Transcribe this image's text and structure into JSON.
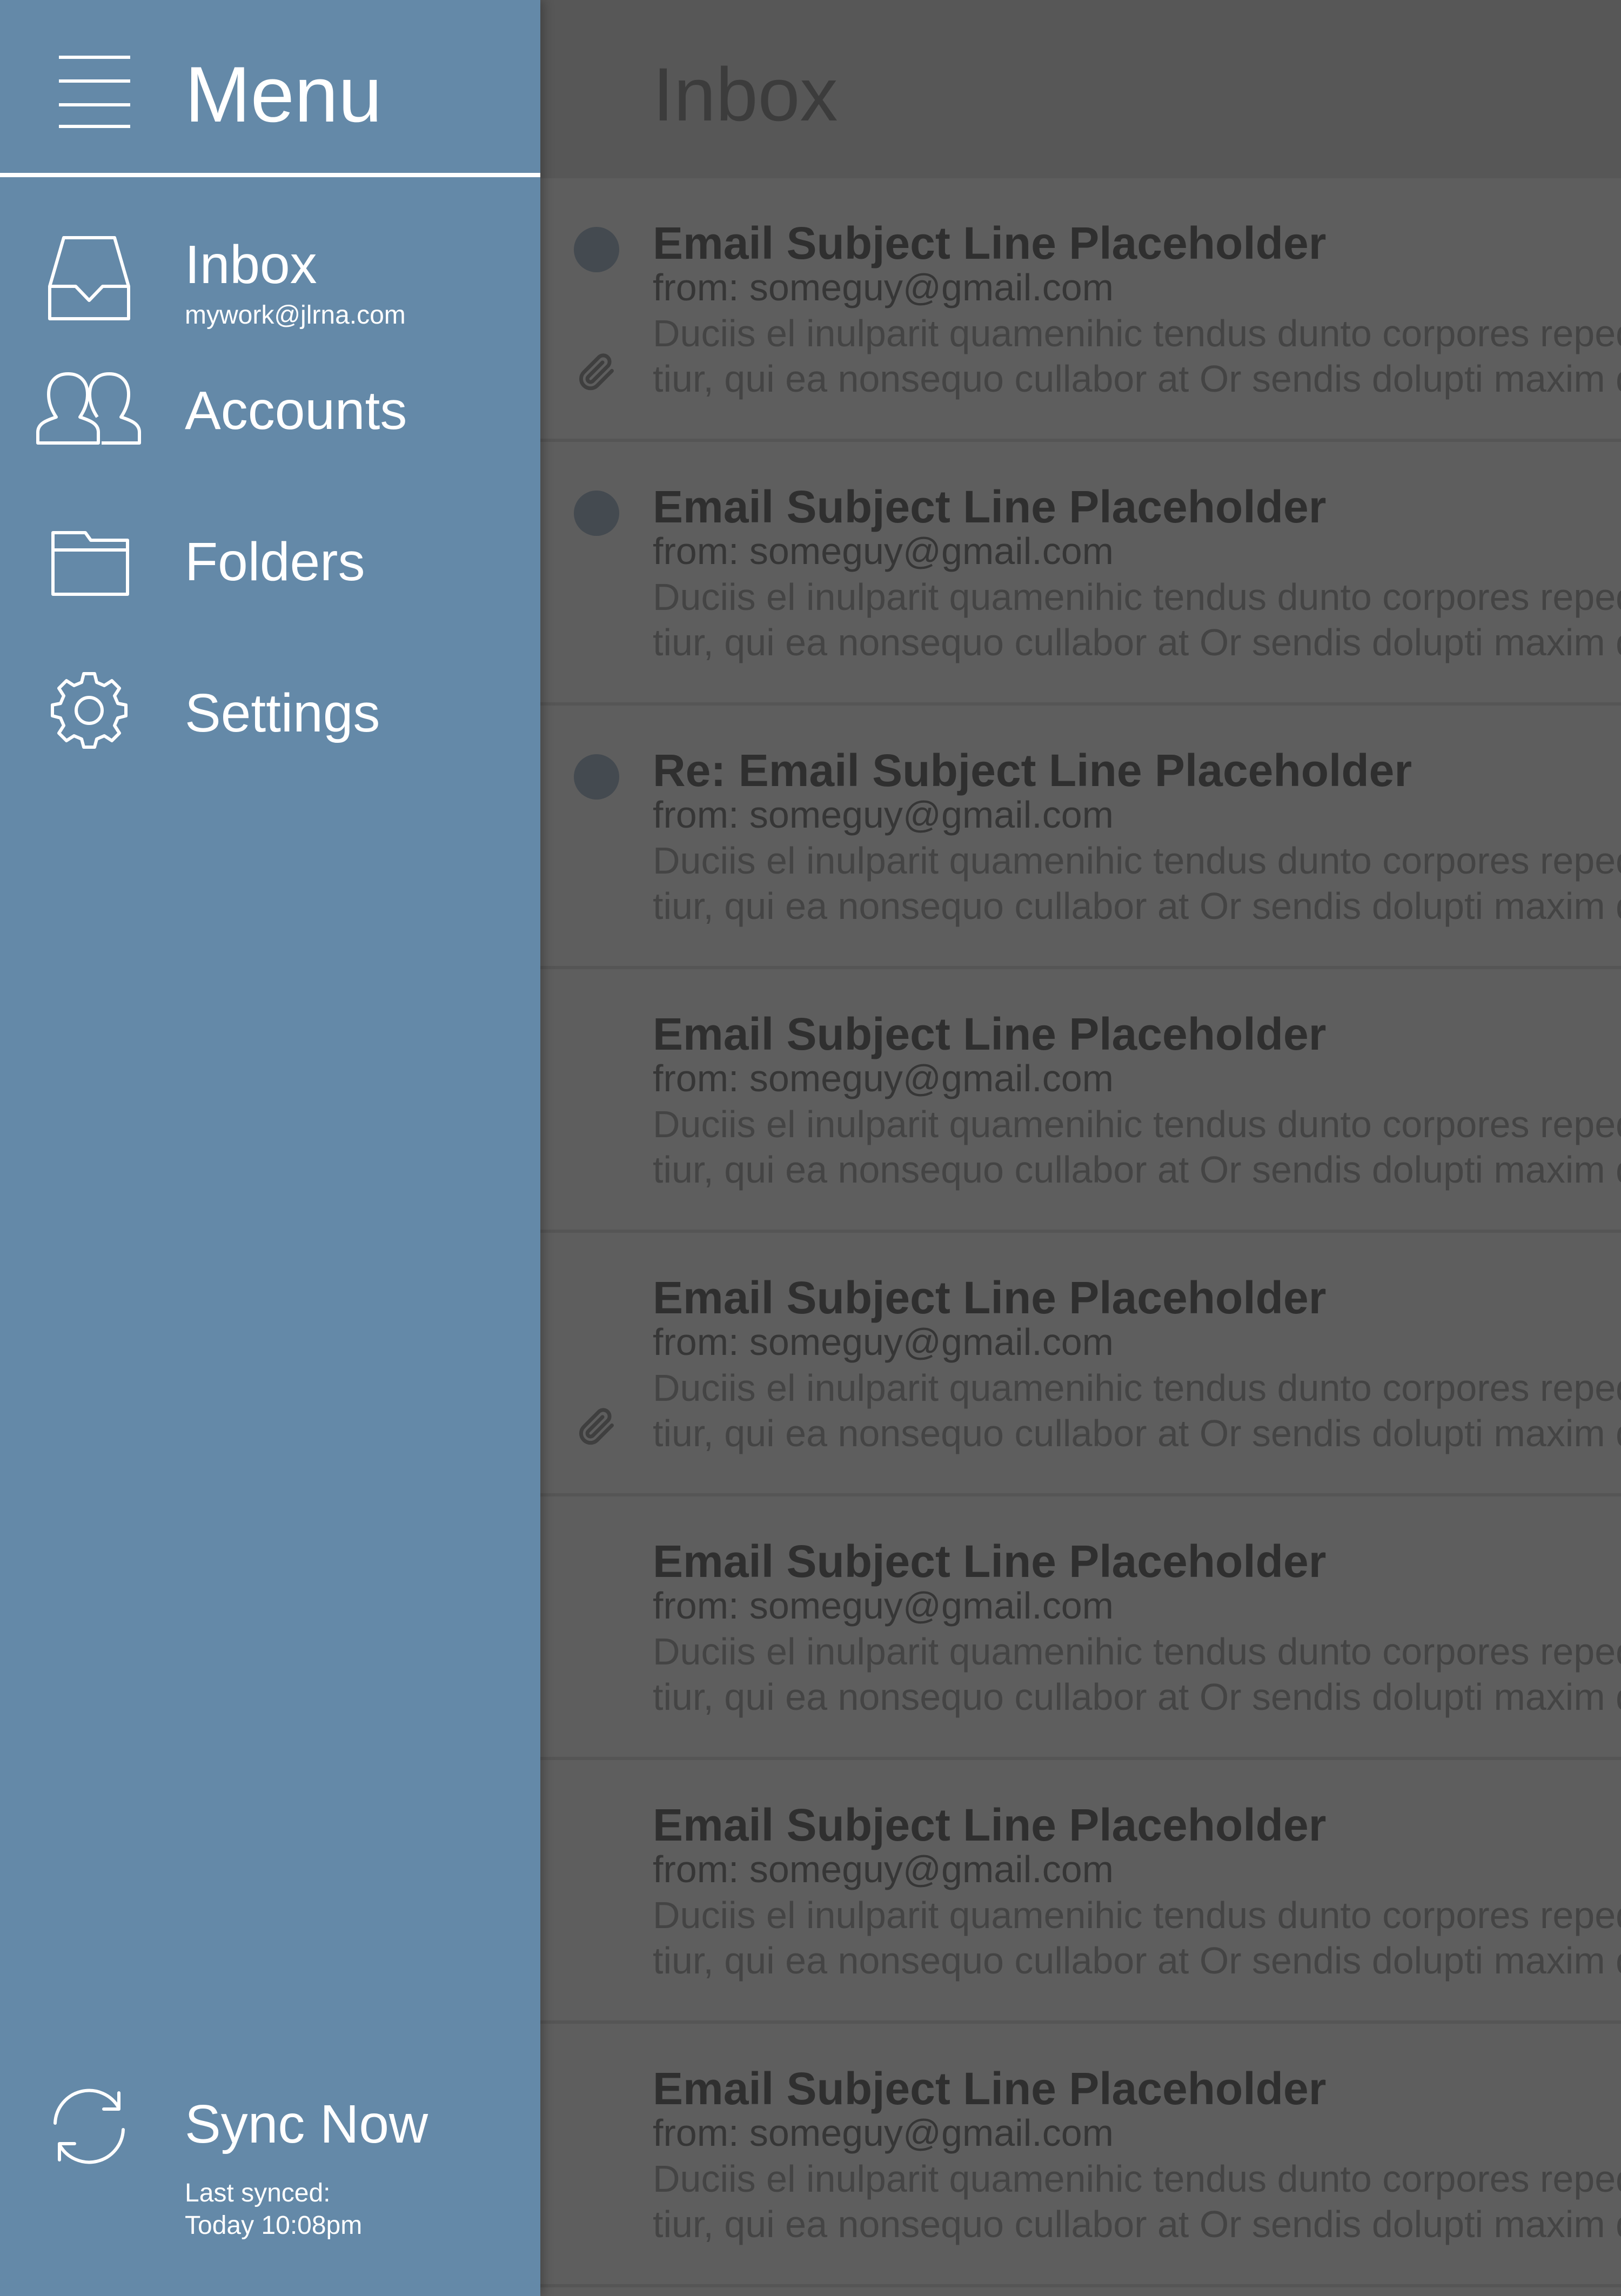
{
  "inbox": {
    "title": "Inbox",
    "emails": [
      {
        "subject": "Email Subject Line Placeholder",
        "from": "from: someguy@gmail.com",
        "preview_line1": "Duciis el inulparit quamenihic tendus dunto corpores reped",
        "preview_line2": "tiur, qui ea nonsequo cullabor at Or sendis dolupti maxim d",
        "unread": true,
        "attachment": true
      },
      {
        "subject": "Email Subject Line Placeholder",
        "from": "from: someguy@gmail.com",
        "preview_line1": "Duciis el inulparit quamenihic tendus dunto corpores reped",
        "preview_line2": "tiur, qui ea nonsequo cullabor at Or sendis dolupti maxim d",
        "unread": true,
        "attachment": false
      },
      {
        "subject": "Re: Email Subject Line Placeholder",
        "from": "from: someguy@gmail.com",
        "preview_line1": "Duciis el inulparit quamenihic tendus dunto corpores reped",
        "preview_line2": "tiur, qui ea nonsequo cullabor at Or sendis dolupti maxim d",
        "unread": true,
        "attachment": false
      },
      {
        "subject": "Email Subject Line Placeholder",
        "from": "from: someguy@gmail.com",
        "preview_line1": "Duciis el inulparit quamenihic tendus dunto corpores reped",
        "preview_line2": "tiur, qui ea nonsequo cullabor at Or sendis dolupti maxim d",
        "unread": false,
        "attachment": false
      },
      {
        "subject": "Email Subject Line Placeholder",
        "from": "from: someguy@gmail.com",
        "preview_line1": "Duciis el inulparit quamenihic tendus dunto corpores reped",
        "preview_line2": "tiur, qui ea nonsequo cullabor at Or sendis dolupti maxim d",
        "unread": false,
        "attachment": true
      },
      {
        "subject": "Email Subject Line Placeholder",
        "from": "from: someguy@gmail.com",
        "preview_line1": "Duciis el inulparit quamenihic tendus dunto corpores reped",
        "preview_line2": "tiur, qui ea nonsequo cullabor at Or sendis dolupti maxim d",
        "unread": false,
        "attachment": false
      },
      {
        "subject": "Email Subject Line Placeholder",
        "from": "from: someguy@gmail.com",
        "preview_line1": "Duciis el inulparit quamenihic tendus dunto corpores reped",
        "preview_line2": "tiur, qui ea nonsequo cullabor at Or sendis dolupti maxim d",
        "unread": false,
        "attachment": false
      },
      {
        "subject": "Email Subject Line Placeholder",
        "from": "from: someguy@gmail.com",
        "preview_line1": "Duciis el inulparit quamenihic tendus dunto corpores reped",
        "preview_line2": "tiur, qui ea nonsequo cullabor at Or sendis dolupti maxim d",
        "unread": false,
        "attachment": false
      }
    ]
  },
  "drawer": {
    "title": "Menu",
    "menu_icon": "hamburger-icon",
    "items": [
      {
        "label": "Inbox",
        "sublabel": "mywork@jlrna.com",
        "icon": "inbox-tray-icon"
      },
      {
        "label": "Accounts",
        "icon": "accounts-icon"
      },
      {
        "label": "Folders",
        "icon": "folder-icon"
      },
      {
        "label": "Settings",
        "icon": "gear-icon"
      }
    ],
    "sync": {
      "label": "Sync Now",
      "last_synced_label": "Last synced:",
      "last_synced_time": "Today 10:08pm",
      "icon": "sync-icon"
    }
  },
  "colors": {
    "drawer_background": "#6489a8",
    "overlay_background": "#5e5e5e",
    "header_divider": "#ffffff"
  }
}
